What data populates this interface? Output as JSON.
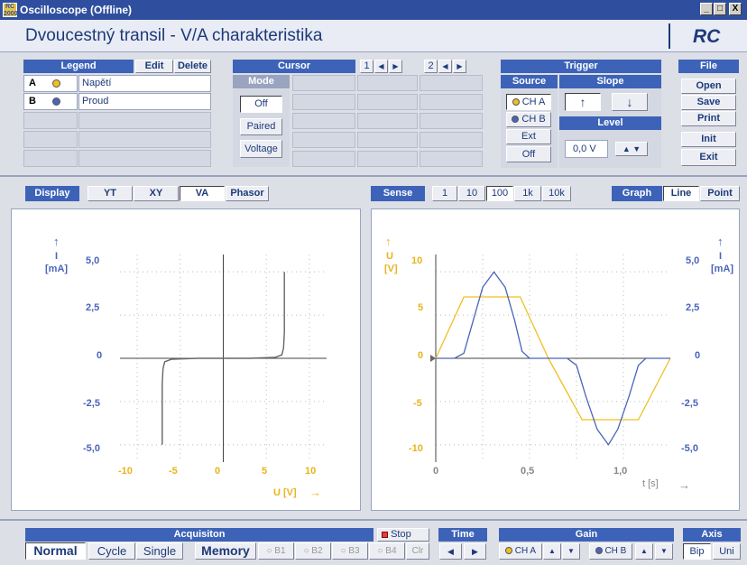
{
  "window": {
    "title": "Oscilloscope (Offline)",
    "app_logo": "RC 2000",
    "controls": [
      "_",
      "□",
      "X"
    ]
  },
  "header": {
    "title": "Dvoucestný transil - V/A charakteristika",
    "logo": "RC"
  },
  "legend": {
    "title": "Legend",
    "edit": "Edit",
    "delete": "Delete",
    "rows": [
      {
        "key": "A",
        "color": "#f0c020",
        "label": "Napětí"
      },
      {
        "key": "B",
        "color": "#4a64b8",
        "label": "Proud"
      }
    ]
  },
  "cursor": {
    "title": "Cursor",
    "mode_label": "Mode",
    "cursor1": "1",
    "cursor2": "2",
    "modes": [
      "Off",
      "Paired",
      "Voltage"
    ]
  },
  "trigger": {
    "title": "Trigger",
    "source_label": "Source",
    "slope_label": "Slope",
    "level_label": "Level",
    "sources": [
      "CH A",
      "CH B",
      "Ext",
      "Off"
    ],
    "slope_up": "↑",
    "slope_down": "↓",
    "level_value": "0,0 V"
  },
  "file": {
    "title": "File",
    "buttons": [
      "Open",
      "Save",
      "Print",
      "Init",
      "Exit"
    ]
  },
  "display": {
    "label": "Display",
    "modes": [
      "YT",
      "XY",
      "VA",
      "Phasor"
    ],
    "active": "VA"
  },
  "sense": {
    "label": "Sense",
    "options": [
      "1",
      "10",
      "100",
      "1k",
      "10k"
    ],
    "active": "100"
  },
  "graph": {
    "label": "Graph",
    "options": [
      "Line",
      "Point"
    ],
    "active": "Line"
  },
  "va_chart": {
    "y_arrow": "↑",
    "y_name": "I",
    "y_unit": "[mA]",
    "y_ticks": [
      "5,0",
      "2,5",
      "0",
      "-2,5",
      "-5,0"
    ],
    "x_ticks": [
      "-10",
      "-5",
      "0",
      "5",
      "10"
    ],
    "x_label": "U [V]",
    "x_arrow": "→"
  },
  "yt_chart": {
    "left_arrow": "↑",
    "left_name": "U",
    "left_unit": "[V]",
    "left_ticks": [
      "10",
      "5",
      "0",
      "-5",
      "-10"
    ],
    "right_arrow": "↑",
    "right_name": "I",
    "right_unit": "[mA]",
    "right_ticks": [
      "5,0",
      "2,5",
      "0",
      "-2,5",
      "-5,0"
    ],
    "x_ticks": [
      "0",
      "0,5",
      "1,0"
    ],
    "x_label": "t [s]",
    "x_arrow": "→"
  },
  "chart_data": [
    {
      "type": "line",
      "x_range": [
        -12,
        12
      ],
      "y_range": [
        -6,
        6
      ],
      "xlabel": "U [V]",
      "ylabel": "I [mA]",
      "series": [
        {
          "color": "#666666",
          "x": [
            -7.1,
            -7.1,
            -7.0,
            -6.8,
            -6.0,
            -3,
            0,
            3,
            6.0,
            6.8,
            7.0,
            7.1,
            7.1
          ],
          "y": [
            -5.0,
            -1.5,
            -0.6,
            -0.2,
            -0.05,
            0,
            0,
            0,
            0.05,
            0.2,
            0.6,
            1.5,
            5.0
          ]
        }
      ]
    },
    {
      "type": "line",
      "x_range": [
        0,
        1.25
      ],
      "y_range": [
        -12,
        12
      ],
      "y2_range": [
        -6,
        6
      ],
      "xlabel": "t [s]",
      "ylabel": "U [V]",
      "y2label": "I [mA]",
      "series": [
        {
          "color": "#f0c020",
          "axis": "left",
          "x": [
            0,
            0.15,
            0.45,
            0.6,
            0.78,
            1.08,
            1.25
          ],
          "y": [
            0,
            7.1,
            7.1,
            0,
            -7.1,
            -7.1,
            0
          ]
        },
        {
          "color": "#4a64b8",
          "axis": "right",
          "x": [
            0,
            0.1,
            0.15,
            0.2,
            0.25,
            0.31,
            0.37,
            0.42,
            0.46,
            0.5,
            0.6,
            0.7,
            0.75,
            0.8,
            0.86,
            0.92,
            0.97,
            1.03,
            1.08,
            1.12,
            1.25
          ],
          "y": [
            0,
            0,
            0.3,
            2.2,
            4.1,
            5.0,
            4.1,
            2.2,
            0.4,
            0,
            0,
            0,
            -0.4,
            -2.2,
            -4.1,
            -5.0,
            -4.1,
            -2.2,
            -0.4,
            0,
            0
          ]
        }
      ]
    }
  ],
  "acquisition": {
    "title": "Acquisiton",
    "stop": "Stop",
    "modes": [
      "Normal",
      "Cycle",
      "Single"
    ],
    "memory": "Memory",
    "slots": [
      "B1",
      "B2",
      "B3",
      "B4"
    ],
    "clear": "Clr"
  },
  "time": {
    "title": "Time",
    "left": "◀",
    "right": "▶"
  },
  "gain": {
    "title": "Gain",
    "cha": "CH A",
    "chb": "CH B"
  },
  "axis": {
    "title": "Axis",
    "options": [
      "Bip",
      "Uni"
    ],
    "active": "Bip"
  }
}
